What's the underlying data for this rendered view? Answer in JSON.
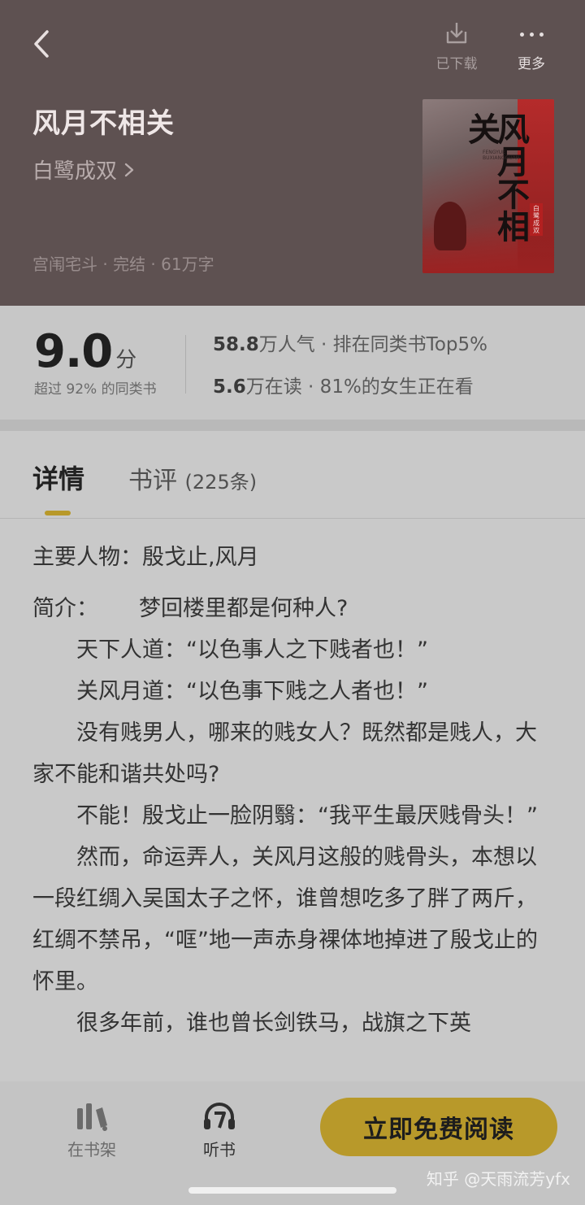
{
  "header": {
    "back_icon": "chevron-left-icon",
    "download_label": "已下载",
    "download_icon": "download-icon",
    "more_label": "更多",
    "more_icon": "more-dots-icon",
    "book_title": "风月不相关",
    "author": "白鹭成双",
    "meta": "宫闱宅斗 · 完结 · 61万字"
  },
  "cover": {
    "title": "风月不相关",
    "subtitle": "FENGYUE BUXIANGGUAN",
    "author": "白鹭成双"
  },
  "stats": {
    "score": "9.0",
    "score_unit": "分",
    "score_sub": "超过 92% 的同类书",
    "popularity_num": "58.8",
    "popularity_text": "万人气 · 排在同类书Top5%",
    "reading_num": "5.6",
    "reading_text": "万在读 · 81%的女生正在看"
  },
  "tabs": {
    "detail": "详情",
    "review": "书评",
    "review_count": "(225条)"
  },
  "content": {
    "roles": "主要人物：殷戈止,风月",
    "intro_label": "简介：",
    "paragraphs": [
      "梦回楼里都是何种人?",
      "天下人道：“以色事人之下贱者也！”",
      "关风月道：“以色事下贱之人者也！”",
      "没有贱男人，哪来的贱女人？既然都是贱人，大家不能和谐共处吗?",
      "不能！殷戈止一脸阴翳：“我平生最厌贱骨头！”",
      "然而，命运弄人，关风月这般的贱骨头，本想以一段红绸入吴国太子之怀，谁曾想吃多了胖了两斤，红绸不禁吊，“哐”地一声赤身裸体地掉进了殷戈止的怀里。",
      "很多年前，谁也曾长剑铁马，战旗之下英"
    ]
  },
  "bottom_bar": {
    "shelf_label": "在书架",
    "shelf_icon": "bookshelf-icon",
    "listen_label": "听书",
    "listen_icon": "headphones-icon",
    "read_button": "立即免费阅读"
  },
  "watermark": "知乎 @天雨流芳yfx",
  "colors": {
    "header_bg": "#5e5151",
    "accent": "#b8992a",
    "overlay_bg": "#c9c9c9"
  }
}
